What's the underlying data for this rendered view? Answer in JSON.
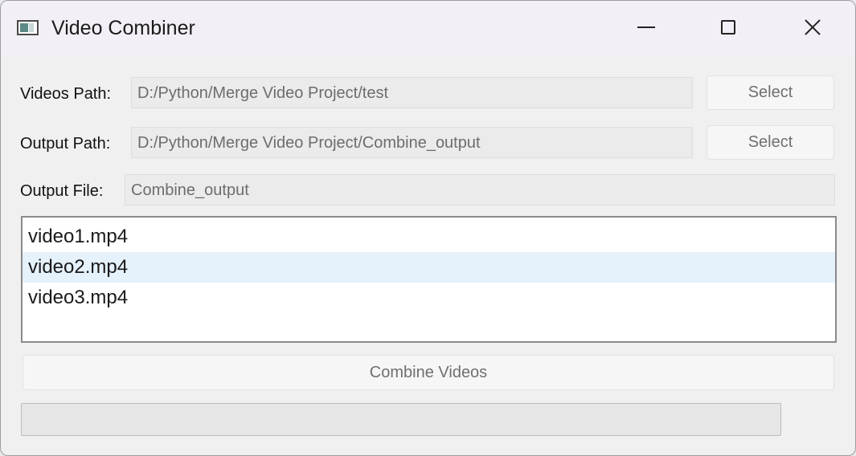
{
  "window": {
    "title": "Video Combiner"
  },
  "form": {
    "videos_path": {
      "label": "Videos Path:",
      "value": "D:/Python/Merge Video Project/test",
      "button": "Select"
    },
    "output_path": {
      "label": "Output Path:",
      "value": "D:/Python/Merge Video Project/Combine_output",
      "button": "Select"
    },
    "output_file": {
      "label": "Output File:",
      "value": "Combine_output"
    }
  },
  "video_list": {
    "items": [
      "video1.mp4",
      "video2.mp4",
      "video3.mp4"
    ],
    "selected_index": 1
  },
  "combine_button": "Combine Videos",
  "progress": {
    "value": 0
  },
  "colors": {
    "selection": "#e5f1fb",
    "progress_fill": "#06b025"
  }
}
